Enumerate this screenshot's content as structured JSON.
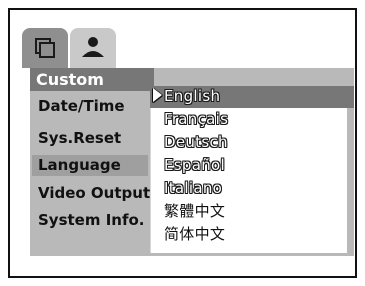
{
  "tabs": [
    {
      "icon": "movie-icon"
    },
    {
      "icon": "user-icon"
    }
  ],
  "section": {
    "title": "Custom"
  },
  "sidebar": {
    "items": [
      {
        "label": "Date/Time"
      },
      {
        "label": "Sys.Reset"
      },
      {
        "label": "Language"
      },
      {
        "label": "Video Output"
      },
      {
        "label": "System Info."
      }
    ],
    "active_index": 2
  },
  "languages": {
    "selected_index": 0,
    "items": [
      {
        "label": "English"
      },
      {
        "label": "Français"
      },
      {
        "label": "Deutsch"
      },
      {
        "label": "Español"
      },
      {
        "label": "Italiano"
      },
      {
        "label": "繁體中文"
      },
      {
        "label": "简体中文"
      }
    ]
  },
  "colors": {
    "panel": "#b9b9b9",
    "header": "#777777",
    "active_item": "#9f9f9f"
  }
}
